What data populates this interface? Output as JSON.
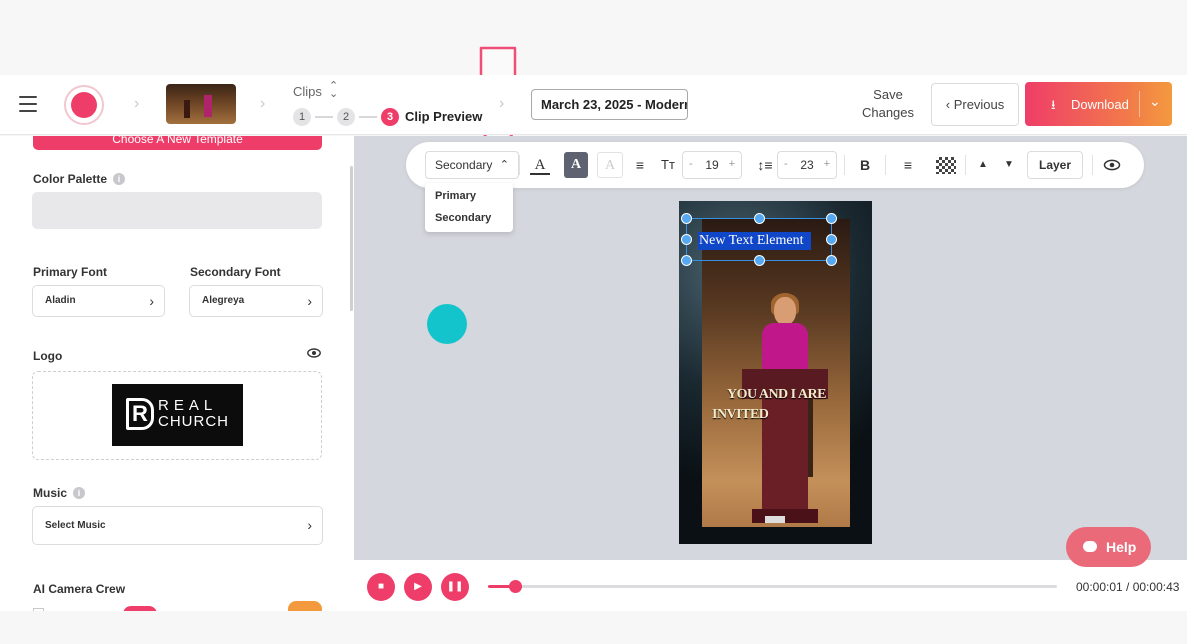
{
  "header": {
    "clips_title": "Clips",
    "steps": [
      "1",
      "2",
      "3"
    ],
    "step_label": "Clip Preview",
    "date_value": "March 23, 2025 - Modern",
    "save_changes": "Save Changes",
    "previous": "Previous",
    "download": "Download"
  },
  "sidebar": {
    "choose_template": "Choose A New Template",
    "color_palette": "Color Palette",
    "primary_font_label": "Primary Font",
    "primary_font_value": "Aladin",
    "secondary_font_label": "Secondary Font",
    "secondary_font_value": "Alegreya",
    "logo_label": "Logo",
    "logo_text_top": "REAL",
    "logo_text_bottom": "CHURCH",
    "music_label": "Music",
    "music_value": "Select Music",
    "ai_camera_label": "AI Camera Crew"
  },
  "toolbar": {
    "font_type": "Secondary",
    "font_size": "19",
    "line_height": "23",
    "layer": "Layer",
    "dropdown_options": [
      "Primary",
      "Secondary"
    ]
  },
  "preview": {
    "text_element": "New Text Element",
    "caption_line1": "YOU AND I ARE",
    "caption_line2": "INVITED"
  },
  "player": {
    "time": "00:00:01 / 00:00:43",
    "progress": 0.048
  },
  "help": {
    "label": "Help"
  },
  "colors": {
    "accent": "#ef3d69",
    "download_gradient_end": "#f39a3e",
    "canvas_bg": "#d5d7de",
    "teal": "#14c4cc",
    "selection": "#56a8f0",
    "help": "#ea6a7a"
  },
  "icons": {
    "hamburger": "menu-icon",
    "record": "record-icon",
    "download": "download-icon",
    "eye": "eye-icon",
    "help": "chat-bubble-icon"
  }
}
